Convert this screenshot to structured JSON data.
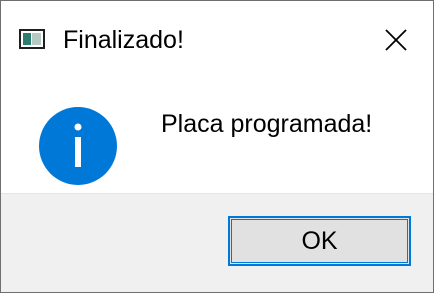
{
  "dialog": {
    "title": "Finalizado!",
    "message": "Placa programada!",
    "ok_label": "OK",
    "app_icon": "app-window-icon",
    "status_icon": "info-icon",
    "close_icon": "close-icon"
  },
  "colors": {
    "info_blue": "#0078d7",
    "button_border": "#0078d7",
    "button_fill": "#e1e1e1",
    "footer_bg": "#f0f0f0"
  }
}
